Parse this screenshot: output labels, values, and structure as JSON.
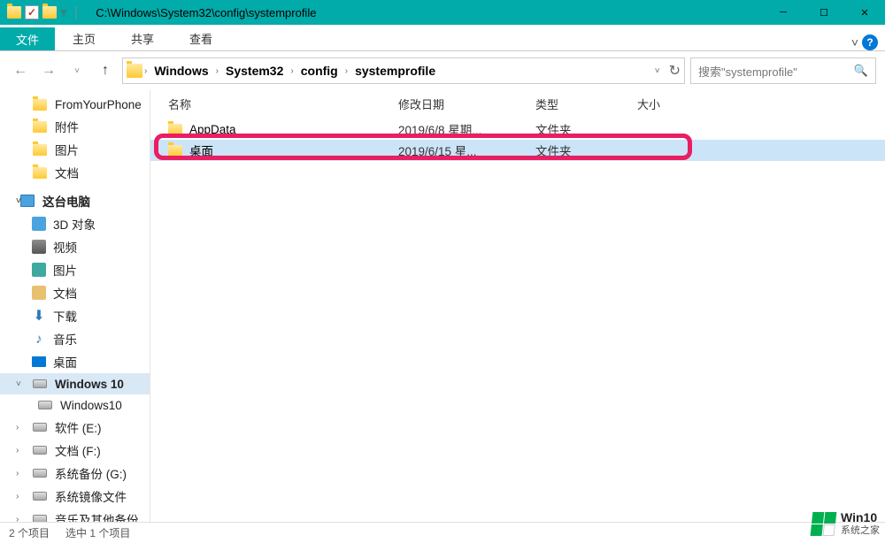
{
  "title": "C:\\Windows\\System32\\config\\systemprofile",
  "ribbon": {
    "file": "文件",
    "home": "主页",
    "share": "共享",
    "view": "查看"
  },
  "breadcrumbs": [
    "Windows",
    "System32",
    "config",
    "systemprofile"
  ],
  "search": {
    "placeholder": "搜索\"systemprofile\""
  },
  "nav": {
    "group1": [
      {
        "label": "FromYourPhone",
        "icon": "folder"
      },
      {
        "label": "附件",
        "icon": "folder"
      },
      {
        "label": "图片",
        "icon": "folder"
      },
      {
        "label": "文档",
        "icon": "folder"
      }
    ],
    "pc_header": "这台电脑",
    "pc_items": [
      {
        "label": "3D 对象",
        "icon": "3d"
      },
      {
        "label": "视频",
        "icon": "video"
      },
      {
        "label": "图片",
        "icon": "pictures"
      },
      {
        "label": "文档",
        "icon": "documents"
      },
      {
        "label": "下载",
        "icon": "downloads"
      },
      {
        "label": "音乐",
        "icon": "music"
      },
      {
        "label": "桌面",
        "icon": "desktop"
      },
      {
        "label": "Windows 10",
        "icon": "disk",
        "selected": true,
        "expandable": true
      },
      {
        "label": "Windows10",
        "icon": "disk",
        "indent": true
      },
      {
        "label": "软件 (E:)",
        "icon": "disk"
      },
      {
        "label": "文档 (F:)",
        "icon": "disk"
      },
      {
        "label": "系统备份 (G:)",
        "icon": "disk"
      },
      {
        "label": "系统镜像文件",
        "icon": "disk"
      },
      {
        "label": "音乐及其他备份",
        "icon": "disk"
      }
    ]
  },
  "columns": {
    "name": "名称",
    "date": "修改日期",
    "type": "类型",
    "size": "大小"
  },
  "files": [
    {
      "name": "AppData",
      "date": "2019/6/8 星期...",
      "type": "文件夹",
      "selected": false
    },
    {
      "name": "桌面",
      "date": "2019/6/15 星...",
      "type": "文件夹",
      "selected": true
    }
  ],
  "status": {
    "items": "2 个项目",
    "selected": "选中 1 个项目"
  },
  "watermark": {
    "line1": "Win10",
    "line2": "系统之家",
    "colors": [
      "#00b050",
      "#00b050",
      "#00b050",
      "#fff"
    ]
  }
}
